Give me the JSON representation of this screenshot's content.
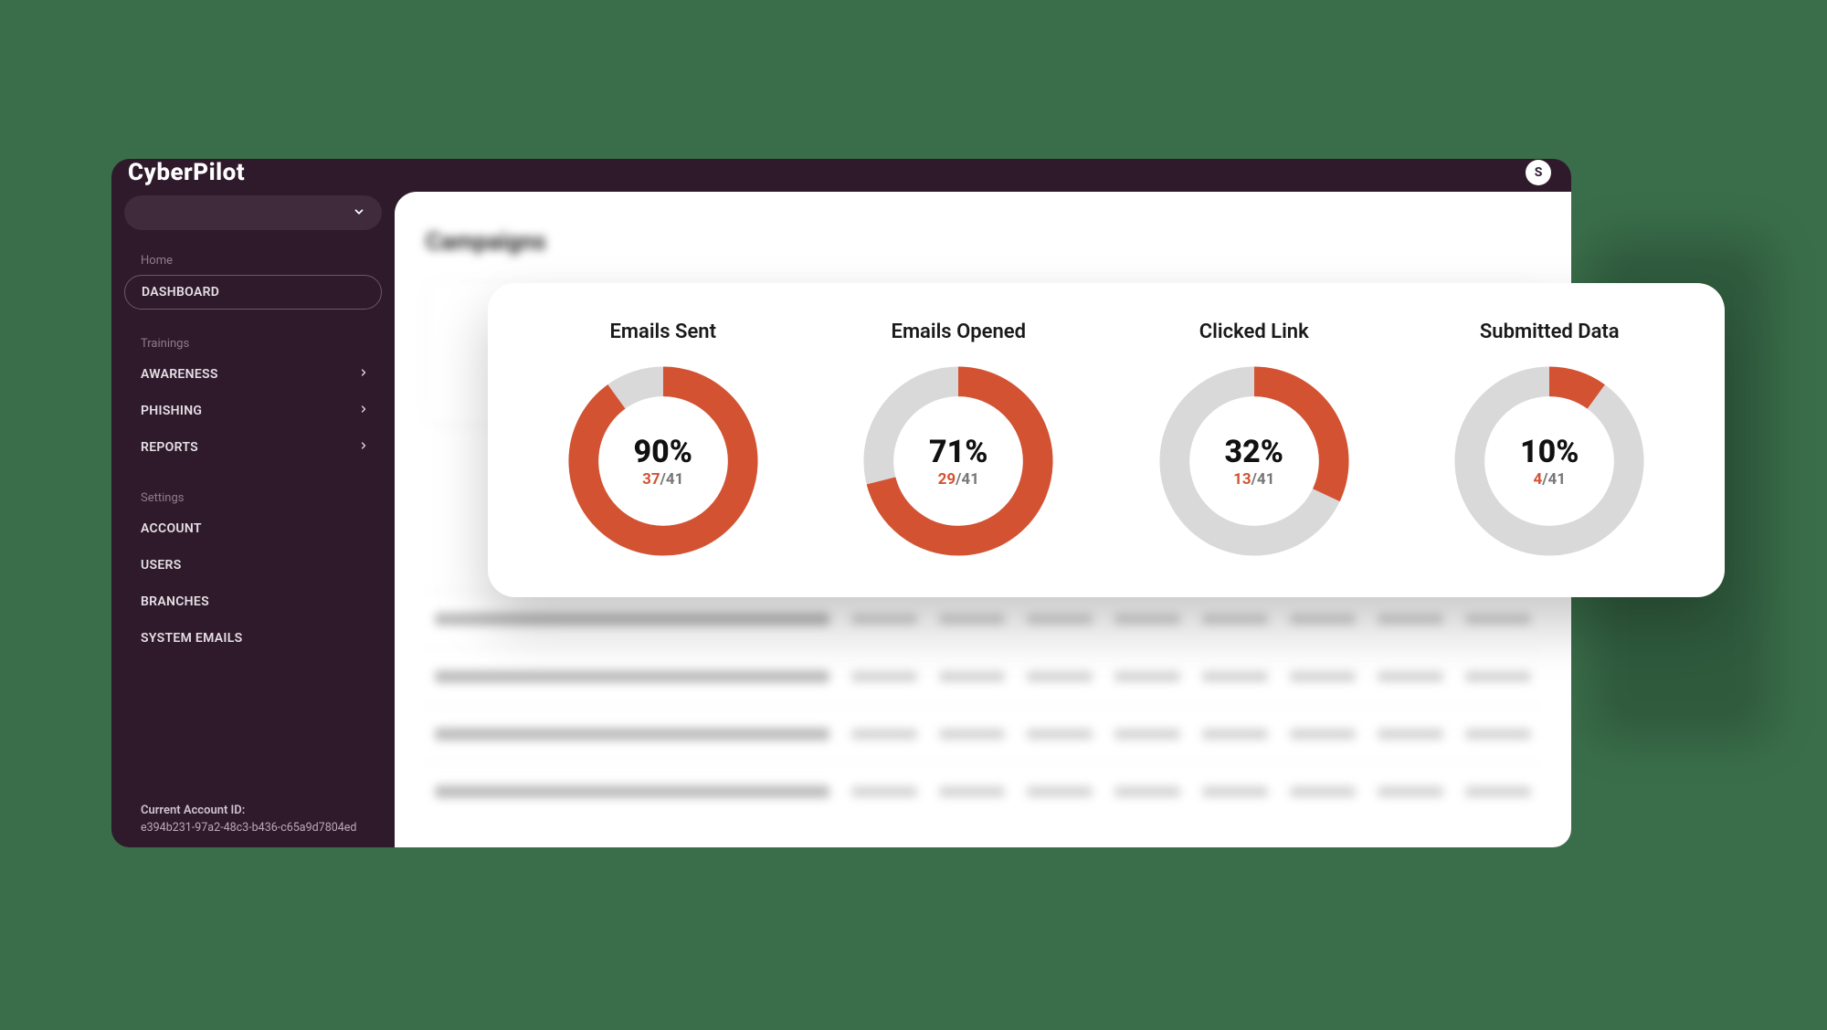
{
  "brand": "CyberPilot",
  "avatar_initial": "S",
  "sidebar": {
    "section_home": "Home",
    "dashboard": "DASHBOARD",
    "section_trainings": "Trainings",
    "awareness": "AWARENESS",
    "phishing": "PHISHING",
    "reports": "REPORTS",
    "section_settings": "Settings",
    "account": "ACCOUNT",
    "users": "USERS",
    "branches": "BRANCHES",
    "system_emails": "SYSTEM EMAILS",
    "account_id_label": "Current Account ID:",
    "account_id_value": "e394b231-97a2-48c3-b436-c65a9d7804ed"
  },
  "main": {
    "page_title": "Campaigns"
  },
  "metrics": [
    {
      "title": "Emails Sent",
      "percent": 90,
      "numerator": 37,
      "denominator": 41
    },
    {
      "title": "Emails Opened",
      "percent": 71,
      "numerator": 29,
      "denominator": 41
    },
    {
      "title": "Clicked Link",
      "percent": 32,
      "numerator": 13,
      "denominator": 41
    },
    {
      "title": "Submitted Data",
      "percent": 10,
      "numerator": 4,
      "denominator": 41
    }
  ],
  "chart_data": [
    {
      "type": "pie",
      "title": "Emails Sent",
      "categories": [
        "value",
        "remainder"
      ],
      "values": [
        90,
        10
      ],
      "numerator": 37,
      "denominator": 41,
      "colors": [
        "#d35232",
        "#d9d9d9"
      ]
    },
    {
      "type": "pie",
      "title": "Emails Opened",
      "categories": [
        "value",
        "remainder"
      ],
      "values": [
        71,
        29
      ],
      "numerator": 29,
      "denominator": 41,
      "colors": [
        "#d35232",
        "#d9d9d9"
      ]
    },
    {
      "type": "pie",
      "title": "Clicked Link",
      "categories": [
        "value",
        "remainder"
      ],
      "values": [
        32,
        68
      ],
      "numerator": 13,
      "denominator": 41,
      "colors": [
        "#d35232",
        "#d9d9d9"
      ]
    },
    {
      "type": "pie",
      "title": "Submitted Data",
      "categories": [
        "value",
        "remainder"
      ],
      "values": [
        10,
        90
      ],
      "numerator": 4,
      "denominator": 41,
      "colors": [
        "#d35232",
        "#d9d9d9"
      ]
    }
  ],
  "colors": {
    "accent": "#d35232",
    "track": "#d9d9d9",
    "sidebar_bg": "#2e1a2b"
  }
}
